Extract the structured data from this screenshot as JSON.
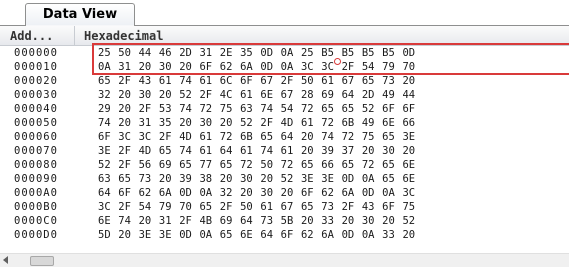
{
  "tab": {
    "label": "Data View"
  },
  "header": {
    "address_label": "Add...",
    "hex_label": "Hexadecimal"
  },
  "rows": [
    {
      "address": "000000",
      "bytes": [
        "25",
        "50",
        "44",
        "46",
        "2D",
        "31",
        "2E",
        "35",
        "0D",
        "0A",
        "25",
        "B5",
        "B5",
        "B5",
        "B5",
        "0D"
      ]
    },
    {
      "address": "000010",
      "bytes": [
        "0A",
        "31",
        "20",
        "30",
        "20",
        "6F",
        "62",
        "6A",
        "0D",
        "0A",
        "3C",
        "3C",
        "2F",
        "54",
        "79",
        "70"
      ]
    },
    {
      "address": "000020",
      "bytes": [
        "65",
        "2F",
        "43",
        "61",
        "74",
        "61",
        "6C",
        "6F",
        "67",
        "2F",
        "50",
        "61",
        "67",
        "65",
        "73",
        "20"
      ]
    },
    {
      "address": "000030",
      "bytes": [
        "32",
        "20",
        "30",
        "20",
        "52",
        "2F",
        "4C",
        "61",
        "6E",
        "67",
        "28",
        "69",
        "64",
        "2D",
        "49",
        "44"
      ]
    },
    {
      "address": "000040",
      "bytes": [
        "29",
        "20",
        "2F",
        "53",
        "74",
        "72",
        "75",
        "63",
        "74",
        "54",
        "72",
        "65",
        "65",
        "52",
        "6F",
        "6F"
      ]
    },
    {
      "address": "000050",
      "bytes": [
        "74",
        "20",
        "31",
        "35",
        "20",
        "30",
        "20",
        "52",
        "2F",
        "4D",
        "61",
        "72",
        "6B",
        "49",
        "6E",
        "66"
      ]
    },
    {
      "address": "000060",
      "bytes": [
        "6F",
        "3C",
        "3C",
        "2F",
        "4D",
        "61",
        "72",
        "6B",
        "65",
        "64",
        "20",
        "74",
        "72",
        "75",
        "65",
        "3E"
      ]
    },
    {
      "address": "000070",
      "bytes": [
        "3E",
        "2F",
        "4D",
        "65",
        "74",
        "61",
        "64",
        "61",
        "74",
        "61",
        "20",
        "39",
        "37",
        "20",
        "30",
        "20"
      ]
    },
    {
      "address": "000080",
      "bytes": [
        "52",
        "2F",
        "56",
        "69",
        "65",
        "77",
        "65",
        "72",
        "50",
        "72",
        "65",
        "66",
        "65",
        "72",
        "65",
        "6E"
      ]
    },
    {
      "address": "000090",
      "bytes": [
        "63",
        "65",
        "73",
        "20",
        "39",
        "38",
        "20",
        "30",
        "20",
        "52",
        "3E",
        "3E",
        "0D",
        "0A",
        "65",
        "6E"
      ]
    },
    {
      "address": "0000A0",
      "bytes": [
        "64",
        "6F",
        "62",
        "6A",
        "0D",
        "0A",
        "32",
        "20",
        "30",
        "20",
        "6F",
        "62",
        "6A",
        "0D",
        "0A",
        "3C"
      ]
    },
    {
      "address": "0000B0",
      "bytes": [
        "3C",
        "2F",
        "54",
        "79",
        "70",
        "65",
        "2F",
        "50",
        "61",
        "67",
        "65",
        "73",
        "2F",
        "43",
        "6F",
        "75"
      ]
    },
    {
      "address": "0000C0",
      "bytes": [
        "6E",
        "74",
        "20",
        "31",
        "2F",
        "4B",
        "69",
        "64",
        "73",
        "5B",
        "20",
        "33",
        "20",
        "30",
        "20",
        "52"
      ]
    },
    {
      "address": "0000D0",
      "bytes": [
        "5D",
        "20",
        "3E",
        "3E",
        "0D",
        "0A",
        "65",
        "6E",
        "64",
        "6F",
        "62",
        "6A",
        "0D",
        "0A",
        "33",
        "20"
      ]
    }
  ],
  "colors": {
    "highlight": "#d93a3a",
    "header_bg": "#e7e9ed"
  }
}
